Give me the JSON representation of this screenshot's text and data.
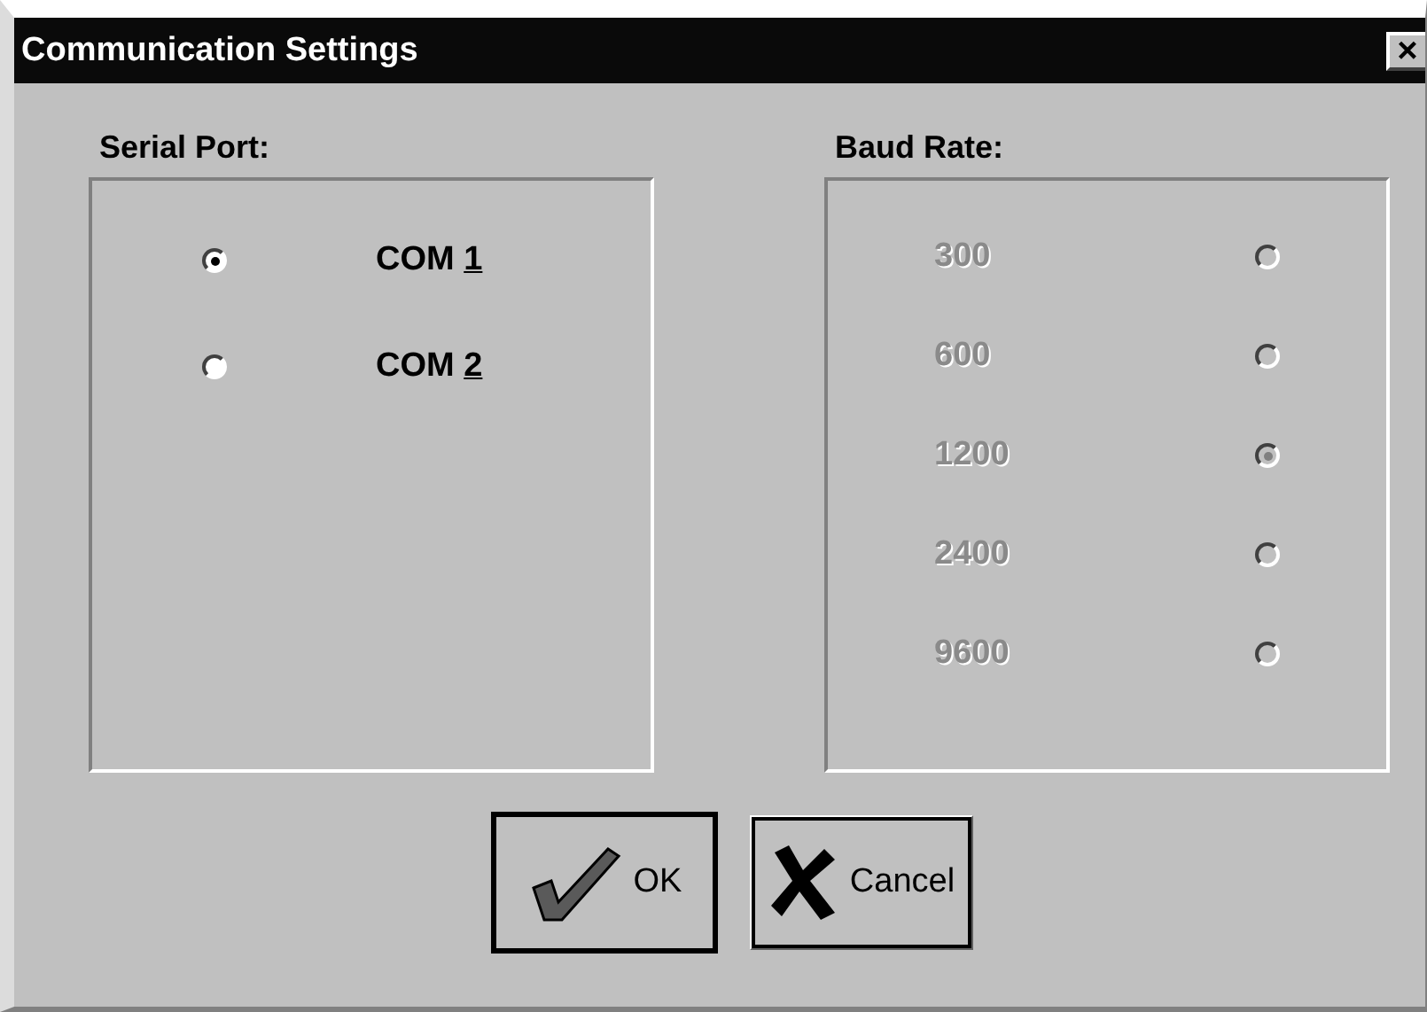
{
  "window": {
    "title": "Communication Settings",
    "close": "×"
  },
  "serial_port": {
    "label": "Serial Port:",
    "disabled": false,
    "options": [
      {
        "label": "COM",
        "hotkey": "1",
        "selected": true
      },
      {
        "label": "COM",
        "hotkey": "2",
        "selected": false
      }
    ]
  },
  "baud_rate": {
    "label": "Baud Rate:",
    "disabled": true,
    "options": [
      {
        "label": "300",
        "selected": false
      },
      {
        "label": "600",
        "selected": false
      },
      {
        "label": "1200",
        "selected": true
      },
      {
        "label": "2400",
        "selected": false
      },
      {
        "label": "9600",
        "selected": false
      }
    ]
  },
  "buttons": [
    {
      "kind": "ok",
      "label": "OK",
      "default": true
    },
    {
      "kind": "cancel",
      "label": "Cancel",
      "default": false
    }
  ]
}
